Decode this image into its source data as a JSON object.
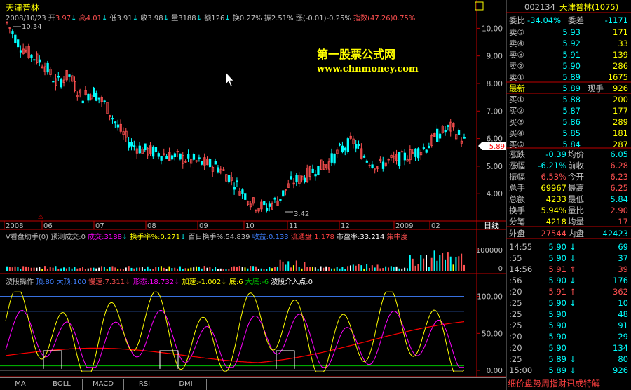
{
  "header": {
    "stock_name": "天津普林",
    "date": "2008/10/23",
    "open_label": "开",
    "open": "3.97",
    "high_label": "高",
    "high": "4.01",
    "low_label": "低",
    "low": "3.91",
    "close_label": "收",
    "close": "3.98",
    "volume_label": "量",
    "volume": "3188",
    "amount_label": "额",
    "amount": "126",
    "turnover_label": "换",
    "turnover": "0.27%",
    "amplitude_label": "振",
    "amplitude": "2.51%",
    "change_label": "涨",
    "change": "(-0.01)-0.25%",
    "index_label": "指数",
    "index": "(47.26)0.75%"
  },
  "watermark": {
    "line1": "第一股票公式网",
    "line2": "www.chnmoney.com"
  },
  "chart_labels": {
    "high_marker": "10.34",
    "low_marker": "3.42",
    "period": "日线",
    "last_price": "5.89"
  },
  "volume_panel": {
    "title": "V看盘助手(0)",
    "forecast": "预测成交:0",
    "volume": "成交:3188",
    "turnover": "换手率%:0.271",
    "hundred_day": "百日换手%:54.839",
    "profit": "收益:0.133",
    "float": "流通盘:1.178",
    "pe": "市盈率:33.214",
    "focus": "集中度",
    "scale": "100000"
  },
  "wave_panel": {
    "title": "波段操作",
    "top": "顶:80",
    "big_top": "大顶:100",
    "slow": "慢速:7.311",
    "shape": "形态:18.732",
    "fast": "加速:-1.002",
    "bottom": "底:6",
    "big_bottom": "大底:-6",
    "entry": "波段介入点:0"
  },
  "colors": {
    "up": "#ff5050",
    "down": "#00ffff",
    "yellow": "#ffff00",
    "red": "#ff0000",
    "white": "#ffffff",
    "magenta": "#ff00ff",
    "blue": "#4080ff"
  },
  "axes": {
    "price_ticks": [
      "10.00",
      "9.00",
      "8.00",
      "7.00",
      "6.00",
      "5.00",
      "4.00"
    ],
    "vol_ticks": [
      "100000",
      "0"
    ],
    "wave_ticks": [
      "100.00",
      "50.00",
      "0.00"
    ],
    "time_labels": [
      "2008",
      "06",
      "07",
      "08",
      "09",
      "10",
      "11",
      "12",
      "2009",
      "02"
    ]
  },
  "chart_data": {
    "type": "candlestick",
    "price_range": [
      3.42,
      10.34
    ],
    "x": [
      "2008",
      "06",
      "07",
      "08",
      "09",
      "10",
      "11",
      "12",
      "2009",
      "02"
    ],
    "close_path": [
      10.2,
      9.4,
      9.0,
      8.7,
      8.0,
      8.3,
      7.5,
      7.7,
      7.2,
      6.4,
      5.8,
      5.6,
      5.5,
      5.4,
      5.3,
      5.2,
      5.1,
      5.0,
      4.6,
      4.1,
      3.6,
      3.5,
      3.8,
      4.4,
      4.6,
      4.9,
      5.1,
      5.6,
      5.9,
      5.3,
      5.0,
      5.2,
      5.3,
      5.5,
      5.7,
      6.2,
      6.4,
      5.9
    ]
  },
  "panel": {
    "code": "002134",
    "name": "天津普林(1075)",
    "ratio_label": "委比",
    "ratio": "-34.04%",
    "diff_label": "委差",
    "diff": "-1171",
    "asks": [
      {
        "label": "卖⑤",
        "price": "5.93",
        "vol": "171"
      },
      {
        "label": "卖④",
        "price": "5.92",
        "vol": "33"
      },
      {
        "label": "卖③",
        "price": "5.91",
        "vol": "139"
      },
      {
        "label": "卖②",
        "price": "5.90",
        "vol": "286"
      },
      {
        "label": "卖①",
        "price": "5.89",
        "vol": "1675"
      }
    ],
    "latest_label": "最新",
    "latest": "5.89",
    "hand_label": "现手",
    "hand": "926",
    "bids": [
      {
        "label": "买①",
        "price": "5.88",
        "vol": "200"
      },
      {
        "label": "买②",
        "price": "5.87",
        "vol": "177"
      },
      {
        "label": "买③",
        "price": "5.86",
        "vol": "289"
      },
      {
        "label": "买④",
        "price": "5.85",
        "vol": "181"
      },
      {
        "label": "买⑤",
        "price": "5.84",
        "vol": "287"
      }
    ],
    "stats": [
      {
        "l1": "涨跌",
        "v1": "-0.39",
        "l2": "均价",
        "v2": "6.05"
      },
      {
        "l1": "涨幅",
        "v1": "-6.21%",
        "l2": "前收",
        "v2": "6.28"
      },
      {
        "l1": "振幅",
        "v1": "6.53%",
        "l2": "今开",
        "v2": "6.23"
      },
      {
        "l1": "总手",
        "v1": "69967",
        "l2": "最高",
        "v2": "6.25"
      },
      {
        "l1": "总额",
        "v1": "4233",
        "l2": "最低",
        "v2": "5.84"
      },
      {
        "l1": "换手",
        "v1": "5.94%",
        "l2": "量比",
        "v2": "2.90"
      },
      {
        "l1": "分笔",
        "v1": "4218",
        "l2": "均量",
        "v2": "17"
      }
    ],
    "outer_label": "外盘",
    "outer": "27544",
    "inner_label": "内盘",
    "inner": "42423",
    "ticks": [
      {
        "t": "14:55",
        "p": "5.90",
        "d": "↓",
        "v": "69"
      },
      {
        "t": ":55",
        "p": "5.90",
        "d": "↓",
        "v": "37"
      },
      {
        "t": "14:56",
        "p": "5.91",
        "d": "↑",
        "v": "39"
      },
      {
        "t": ":56",
        "p": "5.90",
        "d": "↓",
        "v": "176"
      },
      {
        "t": ":20",
        "p": "5.91",
        "d": "↑",
        "v": "362"
      },
      {
        "t": ":25",
        "p": "5.90",
        "d": "↓",
        "v": "10"
      },
      {
        "t": ":25",
        "p": "5.90",
        "d": "",
        "v": "48"
      },
      {
        "t": ":25",
        "p": "5.90",
        "d": "",
        "v": "91"
      },
      {
        "t": ":20",
        "p": "5.90",
        "d": "",
        "v": "29"
      },
      {
        "t": ":20",
        "p": "5.90",
        "d": "",
        "v": "134"
      },
      {
        "t": ":25",
        "p": "5.89",
        "d": "↓",
        "v": "80"
      },
      {
        "t": "15:00",
        "p": "5.89",
        "d": "↓",
        "v": "926"
      }
    ]
  },
  "tabs": [
    "MA",
    "BOLL",
    "MACD",
    "RSI",
    "DMI"
  ],
  "scroll_text": "细价盘势周指财讯成特解"
}
